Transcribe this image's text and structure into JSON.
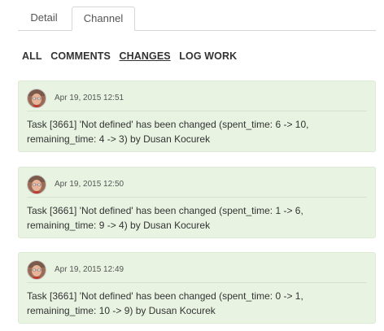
{
  "tabs": [
    {
      "label": "Detail",
      "active": false
    },
    {
      "label": "Channel",
      "active": true
    }
  ],
  "filters": [
    {
      "label": "ALL",
      "active": false
    },
    {
      "label": "COMMENTS",
      "active": false
    },
    {
      "label": "CHANGES",
      "active": true
    },
    {
      "label": "LOG WORK",
      "active": false
    }
  ],
  "entries": [
    {
      "timestamp": "Apr 19, 2015 12:51",
      "text": "Task [3661] 'Not defined' has been changed (spent_time: 6 -> 10, remaining_time: 4 -> 3) by Dusan Kocurek"
    },
    {
      "timestamp": "Apr 19, 2015 12:50",
      "text": "Task [3661] 'Not defined' has been changed (spent_time: 1 -> 6, remaining_time: 9 -> 4) by Dusan Kocurek"
    },
    {
      "timestamp": "Apr 19, 2015 12:49",
      "text": "Task [3661] 'Not defined' has been changed (spent_time: 0 -> 1, remaining_time: 10 -> 9) by Dusan Kocurek"
    }
  ],
  "colors": {
    "card_background": "#e8f3e2",
    "card_border": "#dce9d5",
    "tab_border": "#d6d6d6"
  }
}
